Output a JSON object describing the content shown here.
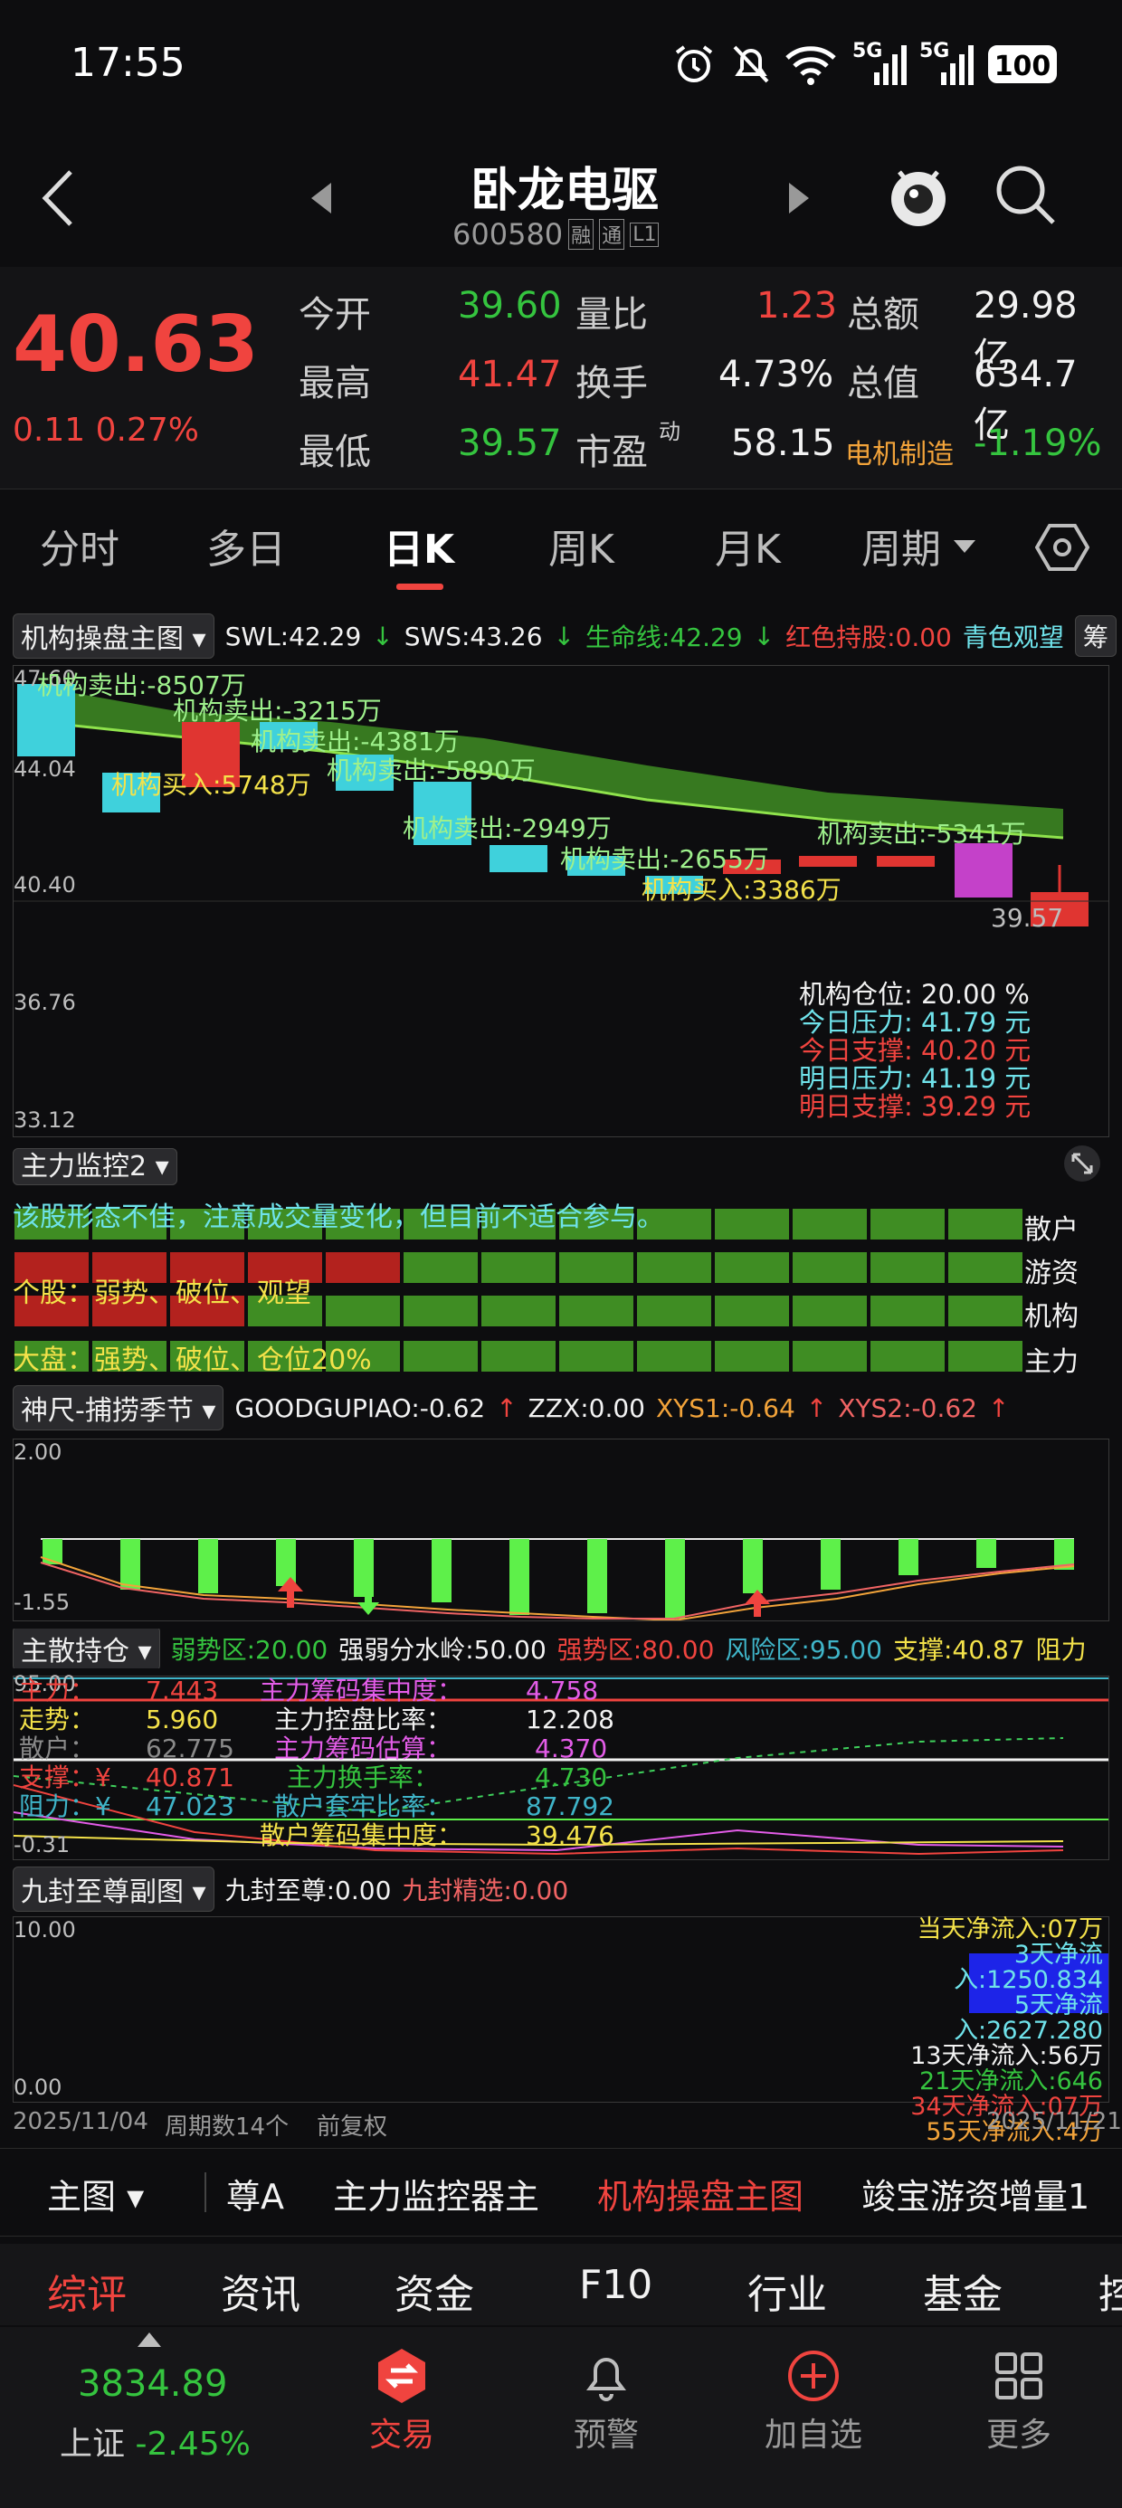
{
  "status": {
    "time": "17:55",
    "battery": "100",
    "net1": "5G",
    "net2": "5G"
  },
  "header": {
    "title": "卧龙电驱",
    "code": "600580",
    "badges": [
      "融",
      "通",
      "L1"
    ]
  },
  "quote": {
    "price": "40.63",
    "change": "0.11",
    "pct": "0.27%",
    "rows": [
      [
        {
          "l": "今开",
          "v": "39.60",
          "c": "green"
        },
        {
          "l": "量比",
          "v": "1.23",
          "c": "red"
        },
        {
          "l": "总额",
          "v": "29.98亿",
          "c": "white"
        }
      ],
      [
        {
          "l": "最高",
          "v": "41.47",
          "c": "red"
        },
        {
          "l": "换手",
          "v": "4.73%",
          "c": "white"
        },
        {
          "l": "总值",
          "v": "634.7亿",
          "c": "white"
        }
      ],
      [
        {
          "l": "最低",
          "v": "39.57",
          "c": "green"
        },
        {
          "l": "市盈",
          "v": "58.15",
          "c": "white"
        },
        {
          "l": "电机制造",
          "v": "-1.19%",
          "c": "green"
        }
      ]
    ],
    "pe_sup": "动"
  },
  "tabs": [
    "分时",
    "多日",
    "日K",
    "周K",
    "月K",
    "周期"
  ],
  "main_ind": {
    "name": "机构操盘主图",
    "swl": "SWL:42.29",
    "sws": "SWS:43.26",
    "life": "生命线:42.29",
    "hold": "红色持股:0.00",
    "watch": "青色观望",
    "chip": "筹",
    "axis": [
      "47.60",
      "44.04",
      "40.40",
      "36.76",
      "33.12"
    ],
    "low_label": "39.57",
    "notes": [
      "机构卖出:-8507万",
      "机构卖出:-3215万",
      "机构卖出:-4381万",
      "机构买入:5748万",
      "机构卖出:-5890万",
      "机构卖出:-2949万",
      "机构卖出:-2655万",
      "机构买入:3386万",
      "机构卖出:-5341万"
    ],
    "info": [
      {
        "l": "机构仓位:",
        "v": "20.00 %",
        "c": "white"
      },
      {
        "l": "今日压力:",
        "v": "41.79 元",
        "c": "cyan"
      },
      {
        "l": "今日支撑:",
        "v": "40.20 元",
        "c": "red"
      },
      {
        "l": "明日压力:",
        "v": "41.19 元",
        "c": "cyan"
      },
      {
        "l": "明日支撑:",
        "v": "39.29 元",
        "c": "red"
      }
    ]
  },
  "monitor": {
    "name": "主力监控2",
    "line1": "该股形态不佳，注意成交量变化，但目前不适合参与。",
    "line2": "个股：弱势、破位、观望",
    "line3": "大盘：强势、破位、仓位20%",
    "labels": [
      "散户",
      "游资",
      "机构",
      "主力"
    ]
  },
  "shenchi": {
    "name": "神尺-捕捞季节",
    "good": "GOODGUPIAO:-0.62",
    "zzx": "ZZX:0.00",
    "xys1": "XYS1:-0.64",
    "xys2": "XYS2:-0.62",
    "axis_top": "2.00",
    "axis_bot": "-1.55"
  },
  "zhusan": {
    "name": "主散持仓",
    "ruo": "弱势区:20.00",
    "fsl": "强弱分水岭:50.00",
    "qiang": "强势区:80.00",
    "fx": "风险区:95.00",
    "zc": "支撑:40.87",
    "zl": "阻力",
    "axis_top": "95.00",
    "axis_bot": "-0.31",
    "rows": [
      {
        "a": "主力：",
        "av": "7.443",
        "b": "主力筹码集中度：",
        "bv": "4.758",
        "ac": "red",
        "bc": "magenta"
      },
      {
        "a": "走势：",
        "av": "5.960",
        "b": "主力控盘比率：",
        "bv": "12.208",
        "ac": "yellow",
        "bc": "white"
      },
      {
        "a": "散户：",
        "av": "62.775",
        "b": "主力筹码估算：",
        "bv": "4.370",
        "ac": "gray",
        "bc": "magenta"
      },
      {
        "a": "支撑：¥",
        "av": "40.871",
        "b": "主力换手率：",
        "bv": "4.730",
        "ac": "red",
        "bc": "green"
      },
      {
        "a": "阻力：¥",
        "av": "47.023",
        "b": "散户套牢比率：",
        "bv": "87.792",
        "ac": "cyan",
        "bc": "cyan"
      },
      {
        "a": "",
        "av": "",
        "b": "散户筹码集中度：",
        "bv": "39.476",
        "ac": "white",
        "bc": "yellow"
      }
    ]
  },
  "jiufeng": {
    "name": "九封至尊副图",
    "jz": "九封至尊:0.00",
    "jx": "九封精选:0.00",
    "axis_top": "10.00",
    "axis_bot": "0.00",
    "flows": [
      {
        "t": "当天净流入:07万",
        "c": "yellow"
      },
      {
        "t": "3天净流入:1250.834",
        "c": "cyan"
      },
      {
        "t": "5天净流入:2627.280",
        "c": "cyan"
      },
      {
        "t": "13天净流入:56万",
        "c": "white"
      },
      {
        "t": "21天净流入:646",
        "c": "green"
      },
      {
        "t": "34天净流入:07万",
        "c": "red"
      },
      {
        "t": "55天净流入:4万",
        "c": "orange"
      }
    ]
  },
  "footer_dates": {
    "start": "2025/11/04",
    "count": "周期数14个",
    "adj": "前复权",
    "end": "2025/11/21"
  },
  "ind_tabs": [
    "主图",
    "尊A",
    "主力监控器主",
    "机构操盘主图",
    "竣宝游资增量1"
  ],
  "sec_tabs": [
    "综评",
    "资讯",
    "资金",
    "F10",
    "行业",
    "基金",
    "控"
  ],
  "index": {
    "value": "3834.89",
    "name": "上证",
    "pct": "-2.45%"
  },
  "nav": [
    "交易",
    "预警",
    "加自选",
    "更多"
  ]
}
